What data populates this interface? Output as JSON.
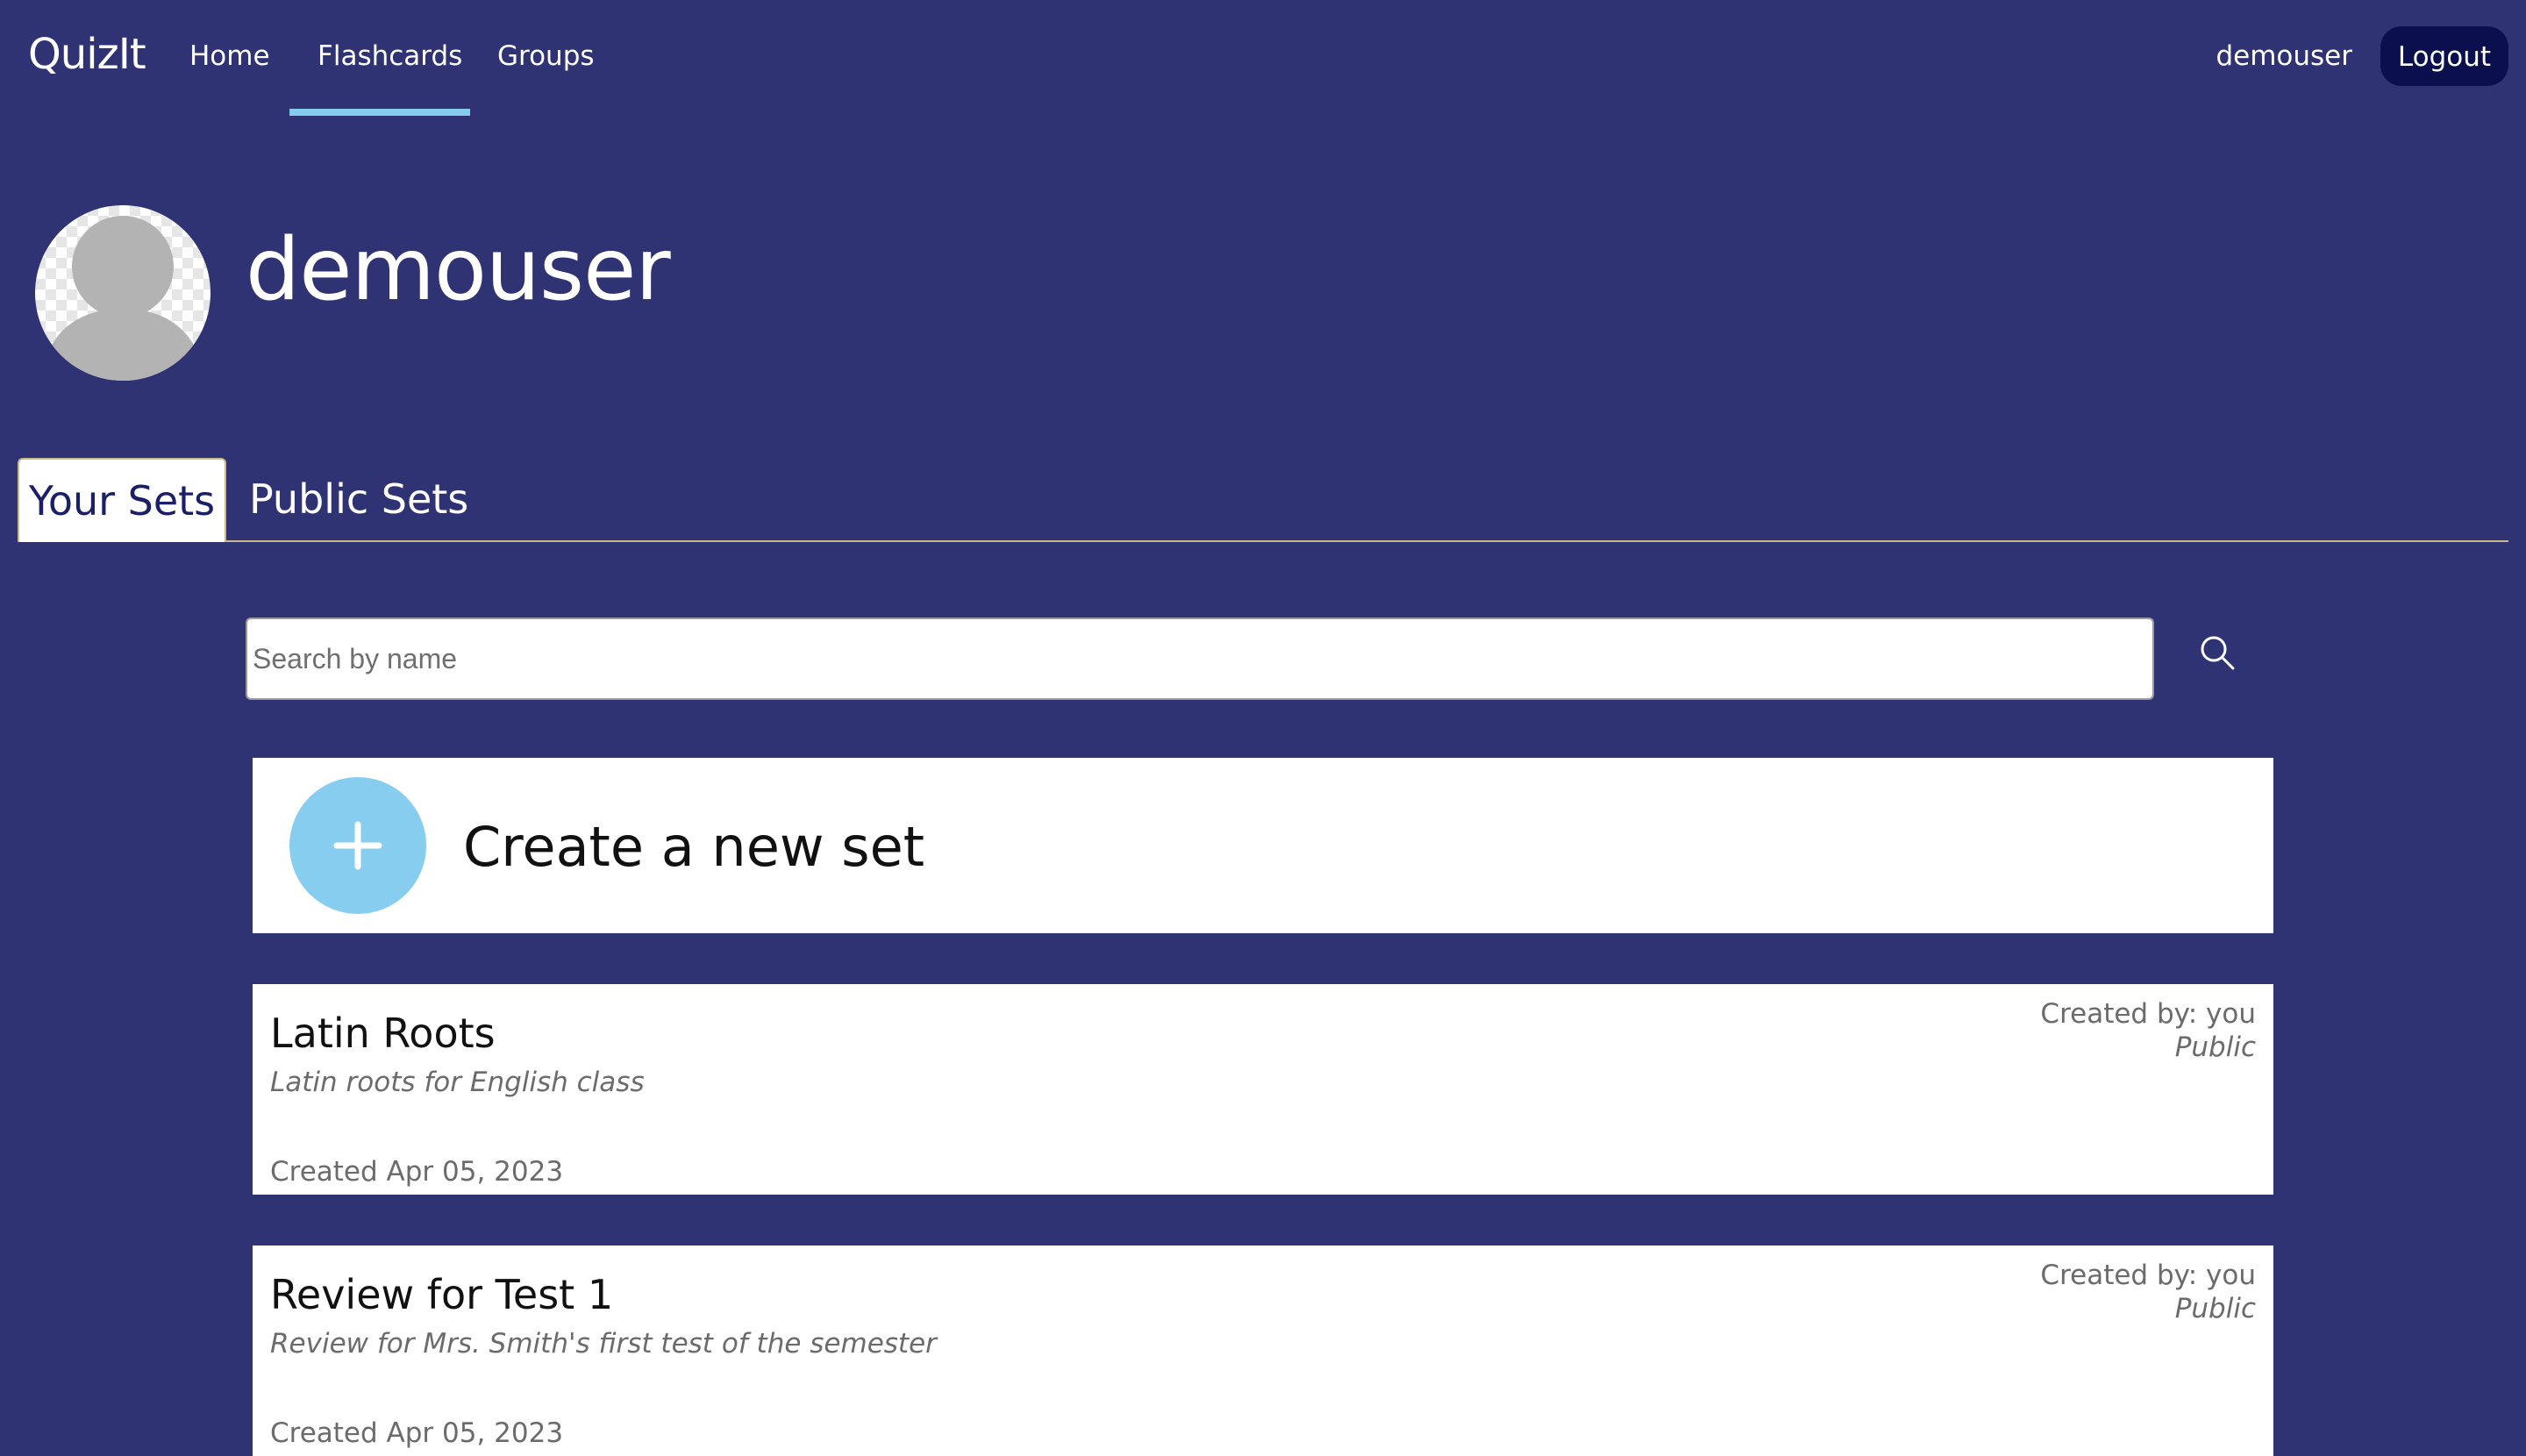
{
  "navbar": {
    "brand": "QuizIt",
    "links": [
      {
        "label": "Home"
      },
      {
        "label": "Flashcards",
        "active": true
      },
      {
        "label": "Groups"
      }
    ],
    "username": "demouser",
    "logout_label": "Logout"
  },
  "profile": {
    "name": "demouser"
  },
  "tabs": [
    {
      "label": "Your Sets",
      "active": true
    },
    {
      "label": "Public Sets",
      "active": false
    }
  ],
  "search": {
    "placeholder": "Search by name",
    "value": "",
    "icon": "search-icon"
  },
  "create": {
    "label": "Create a new set",
    "icon": "plus-icon"
  },
  "sets": [
    {
      "title": "Latin Roots",
      "description": "Latin roots for English class",
      "created": "Created Apr 05, 2023",
      "creator": "Created by: you",
      "visibility": "Public"
    },
    {
      "title": "Review for Test 1",
      "description": "Review for Mrs. Smith's first test of the semester",
      "created": "Created Apr 05, 2023",
      "creator": "Created by: you",
      "visibility": "Public"
    }
  ],
  "colors": {
    "background": "#303373",
    "accent": "#86cdf0",
    "logout_button": "#0c0f4d",
    "tab_active_text": "#1a1f66"
  }
}
